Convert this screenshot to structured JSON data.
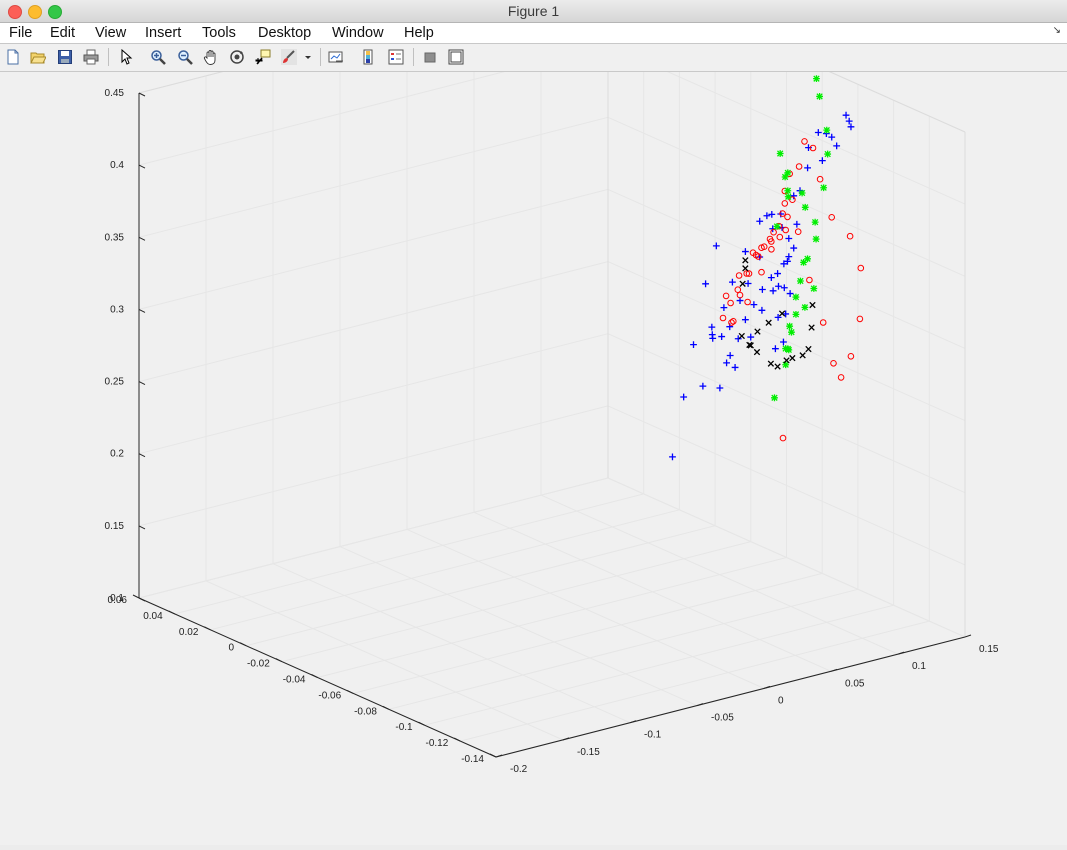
{
  "window": {
    "title": "Figure 1"
  },
  "menu": [
    "File",
    "Edit",
    "View",
    "Insert",
    "Tools",
    "Desktop",
    "Window",
    "Help"
  ],
  "toolbar": [
    {
      "name": "new-figure-icon"
    },
    {
      "name": "open-file-icon"
    },
    {
      "name": "save-icon"
    },
    {
      "name": "print-icon"
    },
    {
      "name": "pointer-icon"
    },
    {
      "name": "zoom-in-icon"
    },
    {
      "name": "zoom-out-icon"
    },
    {
      "name": "pan-hand-icon"
    },
    {
      "name": "rotate-3d-icon"
    },
    {
      "name": "data-cursor-icon"
    },
    {
      "name": "brush-icon"
    },
    {
      "name": "brush-dropdown-icon"
    },
    {
      "name": "link-plot-icon"
    },
    {
      "name": "colorbar-icon"
    },
    {
      "name": "legend-icon"
    },
    {
      "name": "hide-plot-tools-icon"
    },
    {
      "name": "show-plot-tools-icon"
    }
  ],
  "chart_data": {
    "type": "scatter",
    "dimensions": 3,
    "grid": true,
    "axes": {
      "x": {
        "range": [
          -0.14,
          0.06
        ],
        "ticks": [
          "-0.14",
          "-0.12",
          "-0.1",
          "-0.08",
          "-0.06",
          "-0.04",
          "-0.02",
          "0",
          "0.02",
          "0.04",
          "0.06"
        ]
      },
      "y": {
        "range": [
          -0.2,
          0.15
        ],
        "ticks": [
          "-0.2",
          "-0.15",
          "-0.1",
          "-0.05",
          "0",
          "0.05",
          "0.1",
          "0.15"
        ]
      },
      "z": {
        "range": [
          0.1,
          0.45
        ],
        "ticks": [
          "0.1",
          "0.15",
          "0.2",
          "0.25",
          "0.3",
          "0.35",
          "0.4",
          "0.45"
        ]
      }
    },
    "colors": {
      "blue": "#0000ff",
      "red": "#ff0000",
      "green": "#00ee00",
      "black": "#000000"
    },
    "series": [
      {
        "color": "blue",
        "marker": "+",
        "points": [
          [
            -0.115,
            -0.035,
            0.255
          ],
          [
            -0.104,
            -0.012,
            0.285
          ],
          [
            -0.093,
            0.01,
            0.31
          ],
          [
            -0.078,
            0.039,
            0.337
          ],
          [
            -0.066,
            0.063,
            0.351
          ],
          [
            -0.077,
            0.045,
            0.305
          ],
          [
            -0.09,
            0.021,
            0.277
          ],
          [
            -0.08,
            0.047,
            0.264
          ],
          [
            -0.069,
            0.073,
            0.266
          ],
          [
            -0.056,
            0.102,
            0.273
          ],
          [
            -0.045,
            0.125,
            0.28
          ],
          [
            -0.034,
            0.148,
            0.282
          ],
          [
            -0.028,
            0.16,
            0.279
          ],
          [
            -0.02,
            0.175,
            0.27
          ],
          [
            -0.012,
            0.19,
            0.258
          ],
          [
            -0.002,
            0.2,
            0.236
          ],
          [
            0.006,
            0.209,
            0.21
          ],
          [
            0.0,
            0.195,
            0.212
          ],
          [
            0.006,
            0.205,
            0.228
          ],
          [
            0.012,
            0.221,
            0.263
          ],
          [
            0.012,
            0.227,
            0.284
          ],
          [
            0.014,
            0.232,
            0.305
          ],
          [
            0.019,
            0.245,
            0.329
          ],
          [
            0.021,
            0.255,
            0.336
          ],
          [
            0.03,
            0.273,
            0.326
          ],
          [
            0.033,
            0.281,
            0.32
          ],
          [
            0.043,
            0.305,
            0.324
          ],
          [
            0.048,
            0.314,
            0.315
          ],
          [
            0.05,
            0.318,
            0.309
          ],
          [
            0.04,
            0.294,
            0.307
          ],
          [
            0.03,
            0.27,
            0.308
          ],
          [
            0.018,
            0.243,
            0.316
          ],
          [
            0.01,
            0.222,
            0.306
          ],
          [
            -0.003,
            0.195,
            0.307
          ],
          [
            -0.012,
            0.177,
            0.306
          ],
          [
            -0.025,
            0.15,
            0.3
          ],
          [
            -0.038,
            0.124,
            0.295
          ],
          [
            -0.05,
            0.102,
            0.295
          ],
          [
            -0.063,
            0.077,
            0.29
          ],
          [
            -0.075,
            0.055,
            0.295
          ],
          [
            -0.085,
            0.035,
            0.304
          ],
          [
            -0.09,
            0.028,
            0.311
          ],
          [
            -0.08,
            0.05,
            0.319
          ],
          [
            -0.066,
            0.075,
            0.323
          ],
          [
            -0.05,
            0.106,
            0.328
          ],
          [
            -0.031,
            0.142,
            0.33
          ],
          [
            -0.02,
            0.162,
            0.323
          ],
          [
            -0.013,
            0.175,
            0.317
          ],
          [
            -0.006,
            0.192,
            0.3
          ],
          [
            0.0,
            0.205,
            0.286
          ],
          [
            0.004,
            0.214,
            0.275
          ],
          [
            -0.003,
            0.2,
            0.273
          ],
          [
            -0.01,
            0.188,
            0.278
          ],
          [
            -0.02,
            0.17,
            0.281
          ],
          [
            -0.03,
            0.152,
            0.288
          ],
          [
            -0.04,
            0.132,
            0.29
          ],
          [
            -0.048,
            0.115,
            0.288
          ],
          [
            -0.056,
            0.098,
            0.286
          ],
          [
            -0.064,
            0.082,
            0.281
          ],
          [
            -0.07,
            0.068,
            0.276
          ],
          [
            -0.074,
            0.06,
            0.275
          ]
        ]
      },
      {
        "color": "red",
        "marker": "o",
        "points": [
          [
            -0.087,
            0.04,
            0.318
          ],
          [
            -0.08,
            0.055,
            0.321
          ],
          [
            -0.072,
            0.071,
            0.322
          ],
          [
            -0.062,
            0.091,
            0.323
          ],
          [
            -0.052,
            0.113,
            0.324
          ],
          [
            -0.041,
            0.13,
            0.32
          ],
          [
            -0.03,
            0.152,
            0.313
          ],
          [
            -0.019,
            0.173,
            0.305
          ],
          [
            -0.011,
            0.188,
            0.302
          ],
          [
            -0.002,
            0.205,
            0.314
          ],
          [
            0.007,
            0.222,
            0.328
          ],
          [
            0.019,
            0.242,
            0.334
          ],
          [
            0.027,
            0.259,
            0.321
          ],
          [
            0.026,
            0.263,
            0.299
          ],
          [
            0.03,
            0.277,
            0.267
          ],
          [
            0.04,
            0.304,
            0.242
          ],
          [
            0.04,
            0.312,
            0.218
          ],
          [
            0.033,
            0.302,
            0.189
          ],
          [
            0.02,
            0.278,
            0.176
          ],
          [
            0.012,
            0.26,
            0.17
          ],
          [
            0.011,
            0.253,
            0.182
          ],
          [
            0.01,
            0.244,
            0.213
          ],
          [
            0.011,
            0.235,
            0.244
          ],
          [
            0.015,
            0.232,
            0.276
          ],
          [
            0.015,
            0.222,
            0.298
          ],
          [
            0.005,
            0.207,
            0.3
          ],
          [
            -0.008,
            0.183,
            0.3
          ],
          [
            -0.02,
            0.16,
            0.302
          ],
          [
            -0.032,
            0.138,
            0.308
          ],
          [
            -0.043,
            0.118,
            0.306
          ],
          [
            -0.056,
            0.094,
            0.304
          ],
          [
            -0.067,
            0.073,
            0.296
          ],
          [
            -0.056,
            0.089,
            0.287
          ],
          [
            -0.04,
            0.121,
            0.284
          ],
          [
            -0.026,
            0.15,
            0.29
          ],
          [
            -0.012,
            0.176,
            0.292
          ],
          [
            -0.002,
            0.195,
            0.298
          ],
          [
            0.006,
            0.212,
            0.296
          ],
          [
            -0.015,
            0.171,
            0.302
          ],
          [
            -0.034,
            0.133,
            0.312
          ],
          [
            -0.054,
            0.096,
            0.316
          ],
          [
            -0.07,
            0.065,
            0.318
          ],
          [
            0.003,
            0.206,
            0.317
          ],
          [
            0.01,
            0.219,
            0.322
          ],
          [
            -0.005,
            0.194,
            0.153
          ]
        ]
      },
      {
        "color": "green",
        "marker": "*",
        "points": [
          [
            -0.109,
            0.051,
            0.391
          ],
          [
            -0.071,
            0.104,
            0.408
          ],
          [
            -0.073,
            0.107,
            0.395
          ],
          [
            -0.07,
            0.109,
            0.39
          ],
          [
            -0.07,
            0.111,
            0.38
          ],
          [
            -0.068,
            0.114,
            0.374
          ],
          [
            -0.054,
            0.143,
            0.362
          ],
          [
            -0.058,
            0.14,
            0.355
          ],
          [
            -0.015,
            0.208,
            0.392
          ],
          [
            -0.014,
            0.207,
            0.404
          ],
          [
            -0.017,
            0.208,
            0.427
          ],
          [
            0.036,
            0.3,
            0.406
          ],
          [
            0.034,
            0.302,
            0.428
          ],
          [
            0.036,
            0.307,
            0.394
          ],
          [
            0.005,
            0.24,
            0.35
          ],
          [
            0.003,
            0.238,
            0.335
          ],
          [
            0.0,
            0.231,
            0.315
          ],
          [
            -0.005,
            0.218,
            0.297
          ],
          [
            -0.012,
            0.203,
            0.279
          ],
          [
            -0.016,
            0.189,
            0.258
          ],
          [
            -0.023,
            0.175,
            0.245
          ],
          [
            -0.012,
            0.191,
            0.231
          ],
          [
            -0.017,
            0.18,
            0.225
          ],
          [
            -0.013,
            0.187,
            0.221
          ],
          [
            -0.006,
            0.197,
            0.214
          ],
          [
            -0.001,
            0.209,
            0.233
          ],
          [
            0.004,
            0.219,
            0.251
          ],
          [
            0.009,
            0.228,
            0.259
          ],
          [
            0.017,
            0.248,
            0.266
          ],
          [
            0.012,
            0.233,
            0.225
          ],
          [
            0.016,
            0.245,
            0.233
          ],
          [
            -0.016,
            0.173,
            0.192
          ],
          [
            -0.008,
            0.192,
            0.206
          ]
        ]
      },
      {
        "color": "black",
        "marker": "x",
        "points": [
          [
            -0.089,
            0.052,
            0.34
          ],
          [
            -0.083,
            0.062,
            0.345
          ],
          [
            -0.08,
            0.066,
            0.348
          ],
          [
            -0.066,
            0.082,
            0.284
          ],
          [
            -0.062,
            0.093,
            0.273
          ],
          [
            -0.052,
            0.112,
            0.258
          ],
          [
            -0.041,
            0.137,
            0.238
          ],
          [
            -0.032,
            0.154,
            0.227
          ],
          [
            -0.022,
            0.174,
            0.221
          ],
          [
            -0.011,
            0.193,
            0.212
          ],
          [
            -0.004,
            0.21,
            0.206
          ],
          [
            0.001,
            0.221,
            0.205
          ],
          [
            0.006,
            0.23,
            0.215
          ],
          [
            0.01,
            0.236,
            0.227
          ],
          [
            -0.009,
            0.188,
            0.243
          ],
          [
            -0.024,
            0.158,
            0.252
          ],
          [
            -0.038,
            0.131,
            0.26
          ],
          [
            -0.05,
            0.11,
            0.262
          ]
        ]
      }
    ]
  }
}
